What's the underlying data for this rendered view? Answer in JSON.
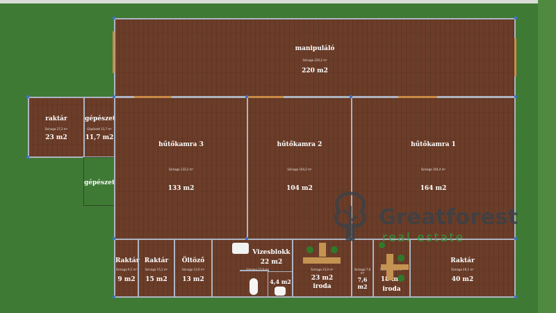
{
  "rooms": [
    {
      "id": "manipulalo",
      "name": "manipuláló",
      "sub": "Szinaga 220,2 m²",
      "area": "220 m2"
    },
    {
      "id": "raktar-left",
      "name": "raktár",
      "sub": "Szinaga 27,2 m²",
      "area": "23 m2"
    },
    {
      "id": "gepeszet-top",
      "name": "gépészet",
      "sub": "Gépészet 11,7 m²",
      "area": "11,7 m2"
    },
    {
      "id": "gepeszet-bottom",
      "name": "gépészet",
      "sub": "",
      "area": ""
    },
    {
      "id": "hutokamra-3",
      "name": "hűtőkamra 3",
      "sub": "Szinaga 133,2 m²",
      "area": "133 m2"
    },
    {
      "id": "hutokamra-2",
      "name": "hűtőkamra 2",
      "sub": "Szinaga 104,2 m²",
      "area": "104 m2"
    },
    {
      "id": "hutokamra-1",
      "name": "hűtőkamra 1",
      "sub": "Szinaga 164,4 m²",
      "area": "164 m2"
    },
    {
      "id": "raktar-9",
      "name": "Raktár",
      "sub": "Szinaga 9,1 m²",
      "area": "9 m2"
    },
    {
      "id": "raktar-15",
      "name": "Raktár",
      "sub": "Szinaga 15,1 m²",
      "area": "15 m2"
    },
    {
      "id": "oltozo",
      "name": "Öltöző",
      "sub": "Szinaga 13,0 m²",
      "area": "13 m2"
    },
    {
      "id": "vizesblokk",
      "name": "Vizesblokk",
      "sub": "Szinaga 22,0 m²",
      "area": "22 m2"
    },
    {
      "id": "small-44",
      "name": "",
      "sub": "",
      "area": "4,4 m2"
    },
    {
      "id": "iroda-23",
      "name": "",
      "sub": "Szinaga 23,0 m²",
      "area": "23 m2",
      "extra": "iroda"
    },
    {
      "id": "small-76",
      "name": "",
      "sub": "Szinaga 7,6 m²",
      "area": "7,6 m2"
    },
    {
      "id": "iroda-18",
      "name": "",
      "sub": "Szinaga 18,0 m²",
      "area": "18 m2",
      "extra": "iroda"
    },
    {
      "id": "raktar-40",
      "name": "Raktár",
      "sub": "Szinaga 40,1 m²",
      "area": "40 m2"
    }
  ],
  "watermark": {
    "brand": "Greatforest",
    "tagline": "real estate",
    "brand_color": "#3c4147",
    "tagline_color": "#2e9e3e"
  },
  "colors": {
    "grass": "#3f7a35",
    "floor": "#6b3d29",
    "walls": "#aeb5c2",
    "doors": "#c98a45",
    "nodes": "#3d73c9"
  }
}
